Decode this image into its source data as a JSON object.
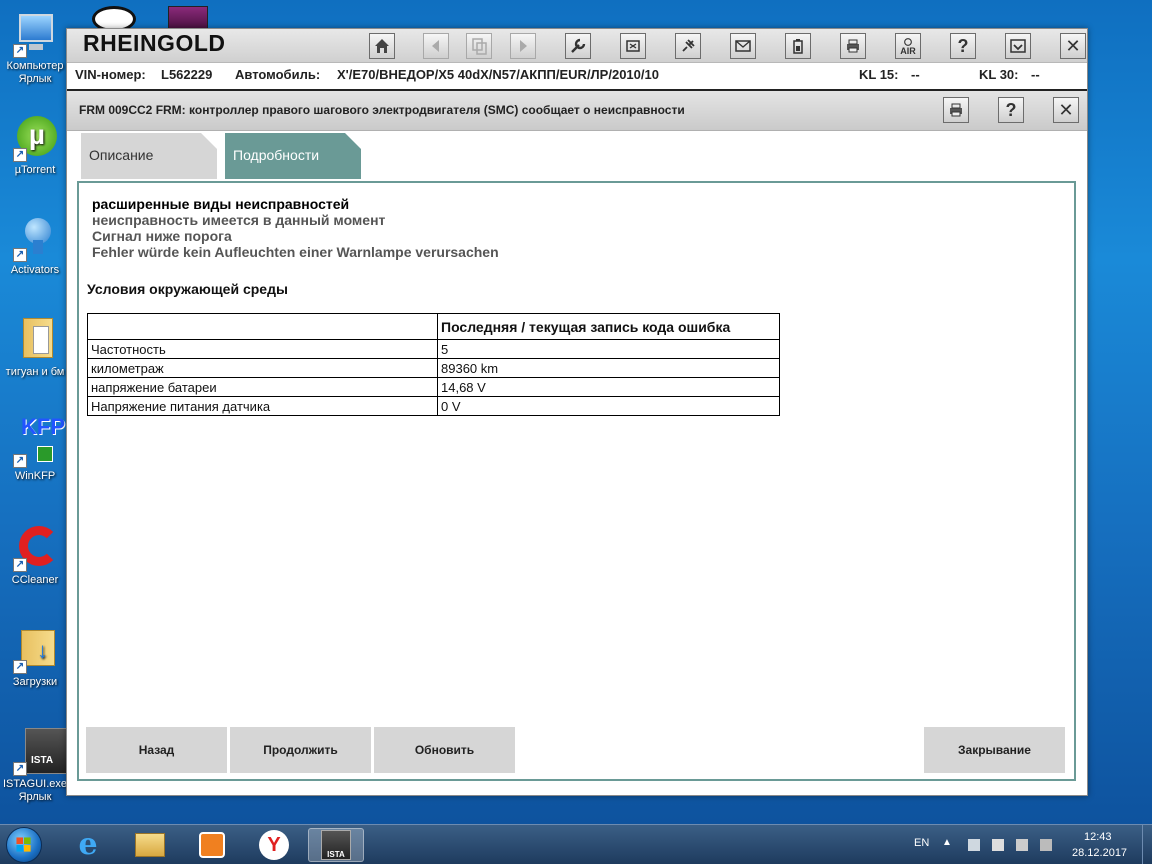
{
  "desktop": {
    "icons": [
      {
        "label": "Компьютер\nЯрлык"
      },
      {
        "label": "µTorrent"
      },
      {
        "label": "Activators"
      },
      {
        "label": "тигуан и бм"
      },
      {
        "label": "WinKFP"
      },
      {
        "label": "CCleaner"
      },
      {
        "label": "Загрузки"
      },
      {
        "label": "ISTAGUI.exe\nЯрлык"
      }
    ],
    "kfp_text": "KFP",
    "ista_text": "ISTA"
  },
  "app": {
    "title": "RHEINGOLD",
    "toolbar": [
      {
        "icon": "home-icon"
      },
      {
        "icon": "arrow-left-icon"
      },
      {
        "icon": "copy-icon"
      },
      {
        "icon": "arrow-right-icon"
      },
      {
        "icon": "wrench-icon"
      },
      {
        "icon": "ecu-icon"
      },
      {
        "icon": "plug-icon"
      },
      {
        "icon": "mail-icon"
      },
      {
        "icon": "battery-icon"
      },
      {
        "icon": "printer-icon"
      },
      {
        "icon": "air-icon",
        "label": "AIR"
      },
      {
        "icon": "help-icon",
        "label": "?"
      },
      {
        "icon": "dropdown-icon"
      },
      {
        "icon": "close-icon",
        "label": "✕"
      }
    ],
    "vehicle": {
      "vin_label": "VIN-номер:",
      "vin_value": "L562229",
      "car_label": "Автомобиль:",
      "car_value": "X'/E70/ВНЕДОР/X5 40dX/N57/АКПП/EUR/ЛР/2010/10",
      "kl15_label": "KL 15:",
      "kl15_value": "--",
      "kl30_label": "KL 30:",
      "kl30_value": "--"
    },
    "fault_title": "FRM 009CC2 FRM: контроллер правого шагового электродвигателя (SMC) сообщает о неисправности",
    "fault_help_label": "?",
    "fault_close_label": "✕",
    "tabs": {
      "description": "Описание",
      "details": "Подробности"
    },
    "details": {
      "heading": "расширенные виды неисправностей",
      "lines": [
        "неисправность имеется в данный момент",
        "Сигнал ниже порога",
        "Fehler würde kein Aufleuchten einer Warnlampe verursachen"
      ],
      "env_heading": "Условия окружающей среды",
      "table_header": "Последняя / текущая запись кода ошибка",
      "rows": [
        {
          "name": "Частотность",
          "value": "5"
        },
        {
          "name": "километраж",
          "value": "89360 km"
        },
        {
          "name": "напряжение батареи",
          "value": "14,68 V"
        },
        {
          "name": "Напряжение питания датчика",
          "value": "0 V"
        }
      ]
    },
    "buttons": {
      "back": "Назад",
      "continue": "Продолжить",
      "refresh": "Обновить",
      "close": "Закрывание"
    }
  },
  "taskbar": {
    "lang": "EN",
    "time": "12:43",
    "date": "28.12.2017",
    "ista_label": "ISTA"
  },
  "colors": {
    "accent_tab": "#6a9a96",
    "button_gray": "#d6d6d6",
    "header_gray": "#d0d0d0"
  }
}
